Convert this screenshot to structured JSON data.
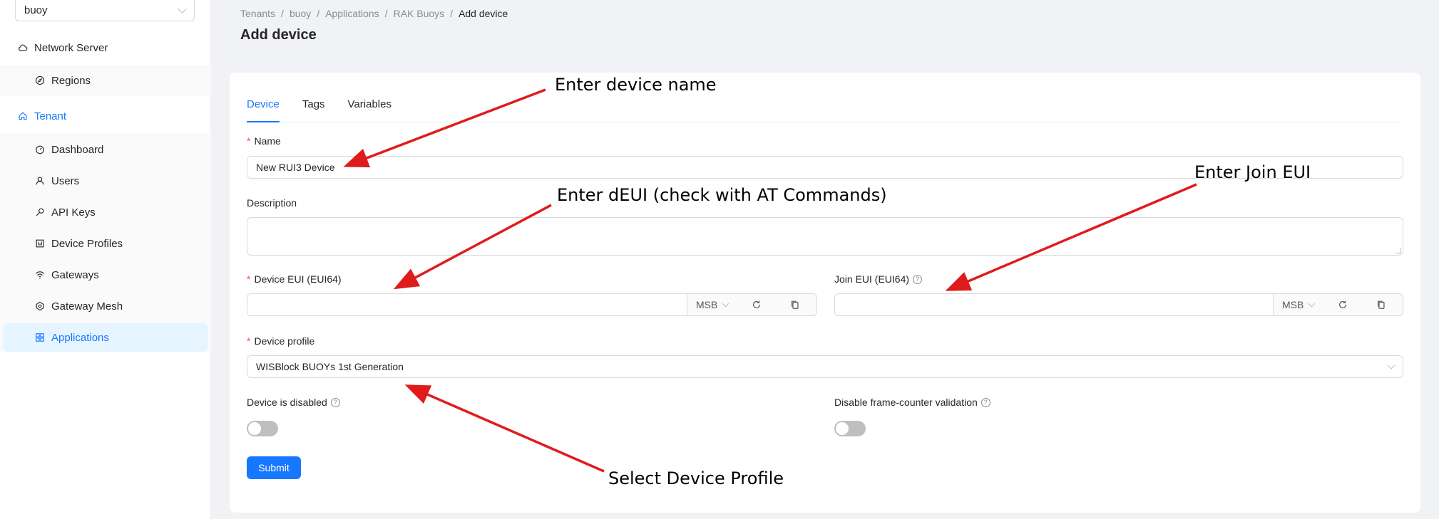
{
  "sidebar": {
    "tenant_select": "buoy",
    "items": [
      {
        "label": "Network Server",
        "icon": "cloud-icon"
      },
      {
        "label": "Regions",
        "icon": "compass-icon"
      },
      {
        "label": "Tenant",
        "icon": "home-icon"
      },
      {
        "label": "Dashboard",
        "icon": "dashboard-icon"
      },
      {
        "label": "Users",
        "icon": "user-icon"
      },
      {
        "label": "API Keys",
        "icon": "key-icon"
      },
      {
        "label": "Device Profiles",
        "icon": "profile-icon"
      },
      {
        "label": "Gateways",
        "icon": "wifi-icon"
      },
      {
        "label": "Gateway Mesh",
        "icon": "mesh-icon"
      },
      {
        "label": "Applications",
        "icon": "apps-icon"
      }
    ]
  },
  "breadcrumb": [
    "Tenants",
    "buoy",
    "Applications",
    "RAK Buoys",
    "Add device"
  ],
  "page_title": "Add device",
  "tabs": [
    "Device",
    "Tags",
    "Variables"
  ],
  "form": {
    "name_label": "Name",
    "name_value": "New RUI3 Device",
    "description_label": "Description",
    "dev_eui_label": "Device EUI (EUI64)",
    "join_eui_label": "Join EUI (EUI64)",
    "byte_order": "MSB",
    "device_profile_label": "Device profile",
    "device_profile_value": "WISBlock BUOYs 1st Generation",
    "disabled_label": "Device is disabled",
    "frame_counter_label": "Disable frame-counter validation",
    "submit_label": "Submit"
  },
  "annotations": {
    "name": "Enter device name",
    "deveui": "Enter dEUI (check with AT Commands)",
    "joineui": "Enter Join EUI",
    "profile": "Select Device Profile"
  },
  "colors": {
    "accent": "#1677ff",
    "arrow": "#e01b1b"
  }
}
